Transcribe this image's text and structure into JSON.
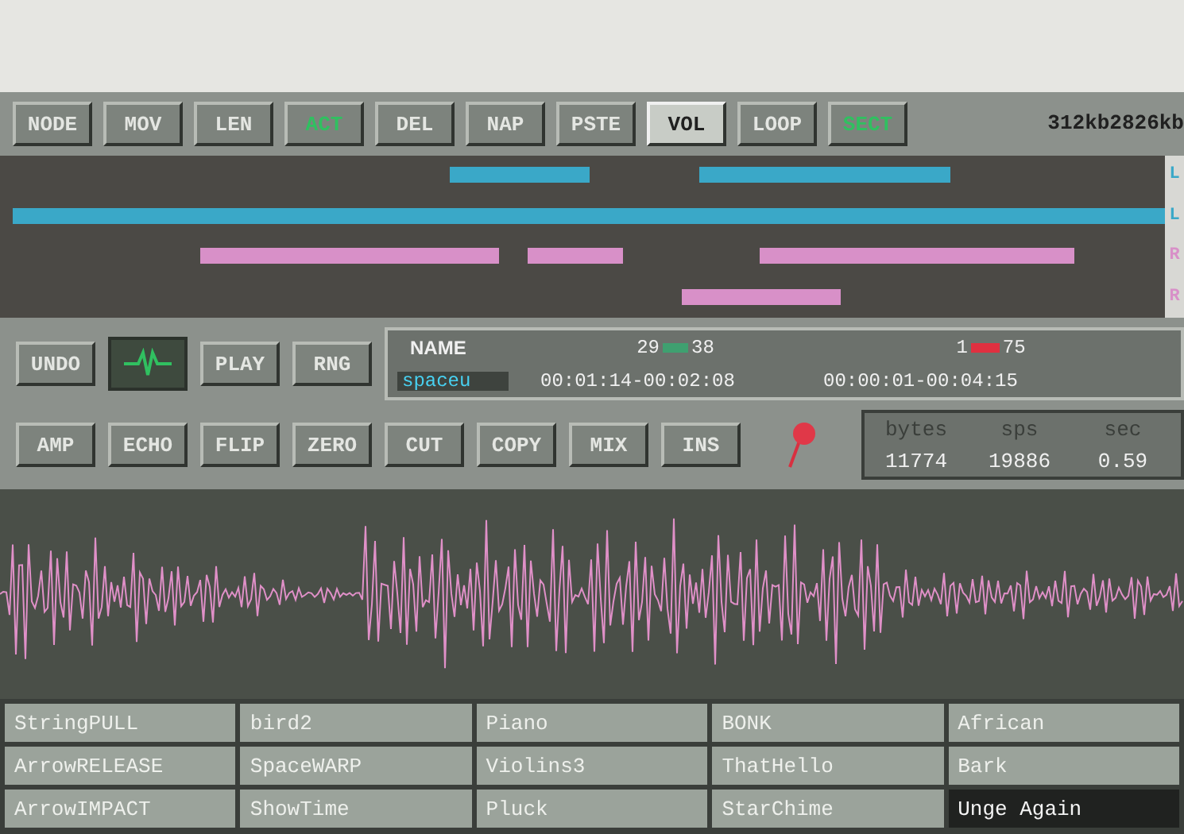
{
  "toolbar": {
    "buttons": [
      {
        "label": "NODE",
        "on": false,
        "selected": false
      },
      {
        "label": "MOV",
        "on": false,
        "selected": false
      },
      {
        "label": "LEN",
        "on": false,
        "selected": false
      },
      {
        "label": "ACT",
        "on": true,
        "selected": false
      },
      {
        "label": "DEL",
        "on": false,
        "selected": false
      },
      {
        "label": "NAP",
        "on": false,
        "selected": false
      },
      {
        "label": "PSTE",
        "on": false,
        "selected": false
      },
      {
        "label": "VOL",
        "on": false,
        "selected": true
      },
      {
        "label": "LOOP",
        "on": false,
        "selected": false
      },
      {
        "label": "SECT",
        "on": true,
        "selected": false
      }
    ],
    "memory": "312kb2826kb"
  },
  "tracks": {
    "channels": [
      {
        "label": "L",
        "color": "#3aa8c8"
      },
      {
        "label": "L",
        "color": "#3aa8c8"
      },
      {
        "label": "R",
        "color": "#d890c8"
      },
      {
        "label": "R",
        "color": "#d890c8"
      }
    ]
  },
  "controls": {
    "row_1": [
      "UNDO",
      "PLAY",
      "RNG"
    ],
    "row_2": [
      "AMP",
      "ECHO",
      "FLIP",
      "ZERO",
      "CUT",
      "COPY",
      "MIX",
      "INS"
    ]
  },
  "info": {
    "name_label": "NAME",
    "name_value": "spaceu",
    "range_1_from": "29",
    "range_1_to": "38",
    "range_1_time": "00:01:14-00:02:08",
    "range_2_from": "1",
    "range_2_to": "75",
    "range_2_time": "00:00:01-00:04:15"
  },
  "stats": {
    "headers": [
      "bytes",
      "sps",
      "sec"
    ],
    "values": [
      "11774",
      "19886",
      "0.59"
    ]
  },
  "samples": [
    {
      "name": "StringPULL",
      "selected": false
    },
    {
      "name": "bird2",
      "selected": false
    },
    {
      "name": "Piano",
      "selected": false
    },
    {
      "name": "BONK",
      "selected": false
    },
    {
      "name": "African",
      "selected": false
    },
    {
      "name": "ArrowRELEASE",
      "selected": false
    },
    {
      "name": "SpaceWARP",
      "selected": false
    },
    {
      "name": "Violins3",
      "selected": false
    },
    {
      "name": "ThatHello",
      "selected": false
    },
    {
      "name": "Bark",
      "selected": false
    },
    {
      "name": "ArrowIMPACT",
      "selected": false
    },
    {
      "name": "ShowTime",
      "selected": false
    },
    {
      "name": "Pluck",
      "selected": false
    },
    {
      "name": "StarChime",
      "selected": false
    },
    {
      "name": "Unge Again",
      "selected": true
    }
  ]
}
